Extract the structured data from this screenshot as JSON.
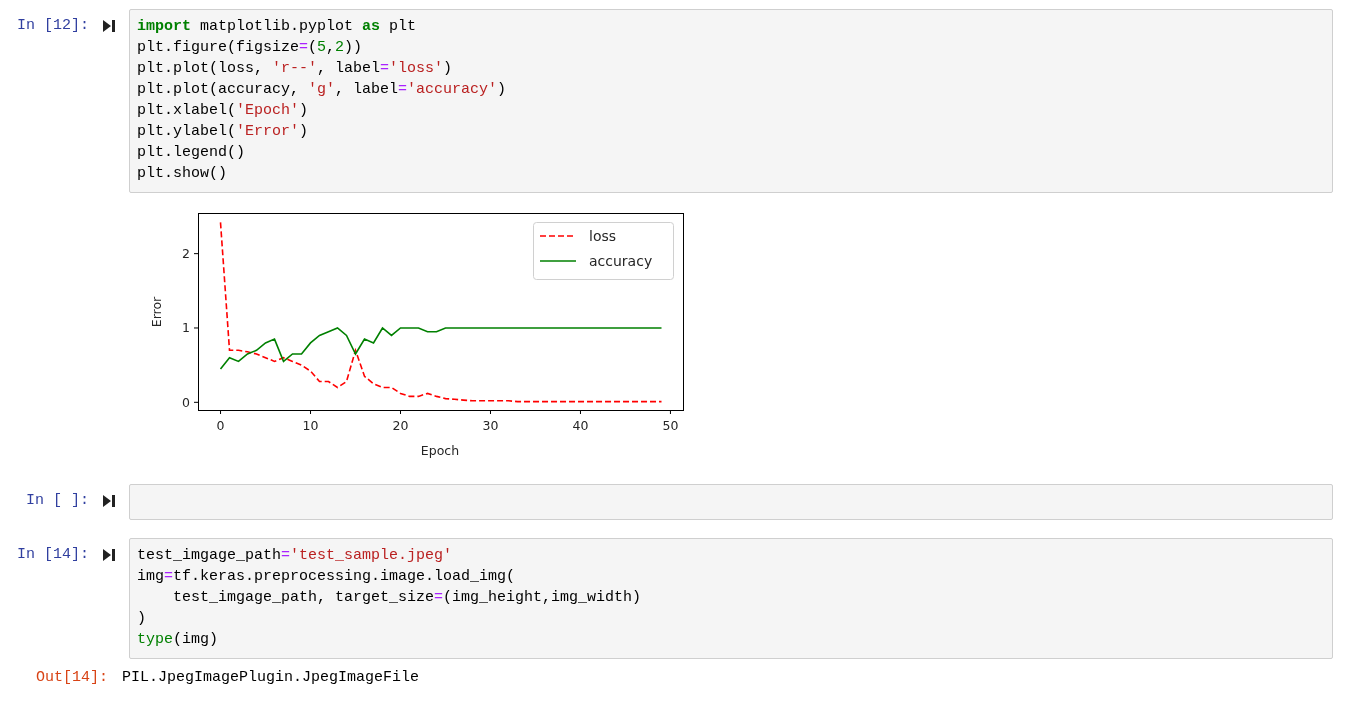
{
  "cells": [
    {
      "prompt": "In [12]:",
      "lines": [
        [
          {
            "text": "import",
            "kind": "keyword"
          },
          {
            "text": " matplotlib.pyplot ",
            "kind": "plain"
          },
          {
            "text": "as",
            "kind": "keyword"
          },
          {
            "text": " plt",
            "kind": "plain"
          }
        ],
        [
          {
            "text": "plt.figure(figsize",
            "kind": "plain"
          },
          {
            "text": "=",
            "kind": "operator"
          },
          {
            "text": "(",
            "kind": "plain"
          },
          {
            "text": "5",
            "kind": "number"
          },
          {
            "text": ",",
            "kind": "plain"
          },
          {
            "text": "2",
            "kind": "number"
          },
          {
            "text": "))",
            "kind": "plain"
          }
        ],
        [
          {
            "text": "plt.plot(loss, ",
            "kind": "plain"
          },
          {
            "text": "'r--'",
            "kind": "string"
          },
          {
            "text": ", label",
            "kind": "plain"
          },
          {
            "text": "=",
            "kind": "operator"
          },
          {
            "text": "'loss'",
            "kind": "string"
          },
          {
            "text": ")",
            "kind": "plain"
          }
        ],
        [
          {
            "text": "plt.plot(accuracy, ",
            "kind": "plain"
          },
          {
            "text": "'g'",
            "kind": "string"
          },
          {
            "text": ", label",
            "kind": "plain"
          },
          {
            "text": "=",
            "kind": "operator"
          },
          {
            "text": "'accuracy'",
            "kind": "string"
          },
          {
            "text": ")",
            "kind": "plain"
          }
        ],
        [
          {
            "text": "plt.xlabel(",
            "kind": "plain"
          },
          {
            "text": "'Epoch'",
            "kind": "string"
          },
          {
            "text": ")",
            "kind": "plain"
          }
        ],
        [
          {
            "text": "plt.ylabel(",
            "kind": "plain"
          },
          {
            "text": "'Error'",
            "kind": "string"
          },
          {
            "text": ")",
            "kind": "plain"
          }
        ],
        [
          {
            "text": "plt.legend()",
            "kind": "plain"
          }
        ],
        [
          {
            "text": "plt.show()",
            "kind": "plain"
          }
        ]
      ],
      "output": {
        "kind": "chart",
        "chart_data": {
          "type": "line",
          "xlabel": "Epoch",
          "ylabel": "Error",
          "x": [
            0,
            1,
            2,
            3,
            4,
            5,
            6,
            7,
            8,
            9,
            10,
            11,
            12,
            13,
            14,
            15,
            16,
            17,
            18,
            19,
            20,
            21,
            22,
            23,
            24,
            25,
            26,
            27,
            28,
            29,
            30,
            31,
            32,
            33,
            34,
            35,
            36,
            37,
            38,
            39,
            40,
            41,
            42,
            43,
            44,
            45,
            46,
            47,
            48,
            49
          ],
          "series": [
            {
              "name": "loss",
              "color": "#ff0000",
              "line_style": "dashed",
              "values": [
                2.42,
                0.7,
                0.7,
                0.68,
                0.65,
                0.6,
                0.55,
                0.6,
                0.55,
                0.5,
                0.42,
                0.28,
                0.28,
                0.2,
                0.28,
                0.7,
                0.35,
                0.25,
                0.2,
                0.2,
                0.12,
                0.08,
                0.08,
                0.12,
                0.08,
                0.05,
                0.04,
                0.03,
                0.02,
                0.02,
                0.02,
                0.02,
                0.02,
                0.01,
                0.01,
                0.01,
                0.01,
                0.01,
                0.01,
                0.01,
                0.01,
                0.01,
                0.01,
                0.01,
                0.01,
                0.01,
                0.01,
                0.01,
                0.01,
                0.01
              ]
            },
            {
              "name": "accuracy",
              "color": "#008000",
              "line_style": "solid",
              "values": [
                0.45,
                0.6,
                0.55,
                0.65,
                0.7,
                0.8,
                0.85,
                0.55,
                0.65,
                0.65,
                0.8,
                0.9,
                0.95,
                1.0,
                0.9,
                0.65,
                0.85,
                0.8,
                1.0,
                0.9,
                1.0,
                1.0,
                1.0,
                0.95,
                0.95,
                1.0,
                1.0,
                1.0,
                1.0,
                1.0,
                1.0,
                1.0,
                1.0,
                1.0,
                1.0,
                1.0,
                1.0,
                1.0,
                1.0,
                1.0,
                1.0,
                1.0,
                1.0,
                1.0,
                1.0,
                1.0,
                1.0,
                1.0,
                1.0,
                1.0
              ]
            }
          ],
          "xlim": [
            -2.45,
            51.45
          ],
          "ylim": [
            -0.11,
            2.54
          ],
          "xticks": [
            0,
            10,
            20,
            30,
            40,
            50
          ],
          "yticks": [
            0,
            1,
            2
          ],
          "legend": true
        }
      }
    },
    {
      "prompt": "In [ ]:"
    },
    {
      "prompt": "In [14]:",
      "lines": [
        [
          {
            "text": "test_imgage_path",
            "kind": "plain"
          },
          {
            "text": "=",
            "kind": "operator"
          },
          {
            "text": "'test_sample.jpeg'",
            "kind": "string"
          }
        ],
        [
          {
            "text": "img",
            "kind": "plain"
          },
          {
            "text": "=",
            "kind": "operator"
          },
          {
            "text": "tf.keras.preprocessing.image.load_img(",
            "kind": "plain"
          }
        ],
        [
          {
            "text": "    test_imgage_path, target_size",
            "kind": "plain"
          },
          {
            "text": "=",
            "kind": "operator"
          },
          {
            "text": "(img_height,img_width)",
            "kind": "plain"
          }
        ],
        [
          {
            "text": ")",
            "kind": "plain"
          }
        ],
        [
          {
            "text": "type",
            "kind": "builtin"
          },
          {
            "text": "(img)",
            "kind": "plain"
          }
        ]
      ],
      "output": {
        "kind": "text",
        "prompt": "Out[14]:",
        "text": "PIL.JpegImagePlugin.JpegImageFile"
      }
    }
  ]
}
